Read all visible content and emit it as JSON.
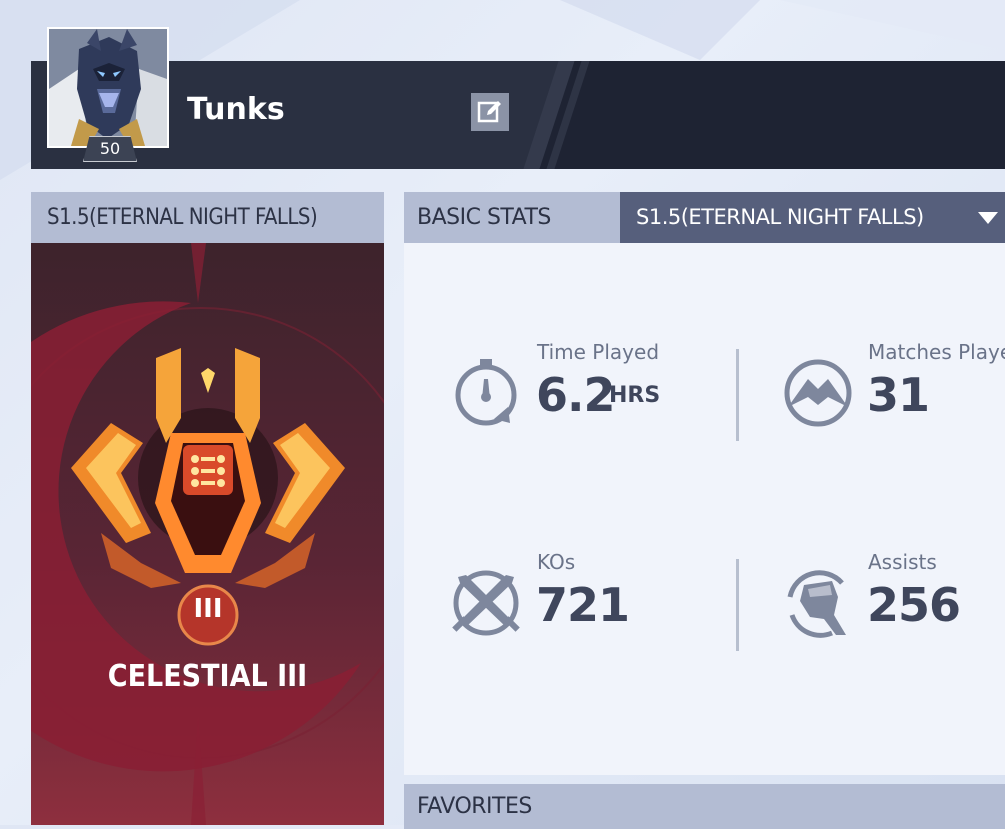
{
  "profile": {
    "username": "Tunks",
    "level": "50"
  },
  "season_card": {
    "title": "S1.5(ETERNAL NIGHT FALLS)",
    "rank_name": "CELESTIAL III",
    "rank_tier": "III"
  },
  "stats": {
    "title": "BASIC STATS",
    "season_selected": "S1.5(ETERNAL NIGHT FALLS)",
    "items": [
      {
        "label": "Time Played",
        "value": "6.2",
        "unit": "HRS",
        "icon": "stopwatch-icon"
      },
      {
        "label": "Matches Playe",
        "value": "31",
        "unit": "",
        "icon": "matches-icon"
      },
      {
        "label": "KOs",
        "value": "721",
        "unit": "",
        "icon": "crossed-swords-icon"
      },
      {
        "label": "Assists",
        "value": "256",
        "unit": "",
        "icon": "fist-icon"
      }
    ]
  },
  "favorites": {
    "title": "FAVORITES"
  },
  "colors": {
    "header_dark": "#1e2333",
    "panel_header": "#b3bcd3",
    "select_bg": "#565f7c",
    "rank_card": "#5a2535",
    "stat_value": "#3f465c"
  }
}
